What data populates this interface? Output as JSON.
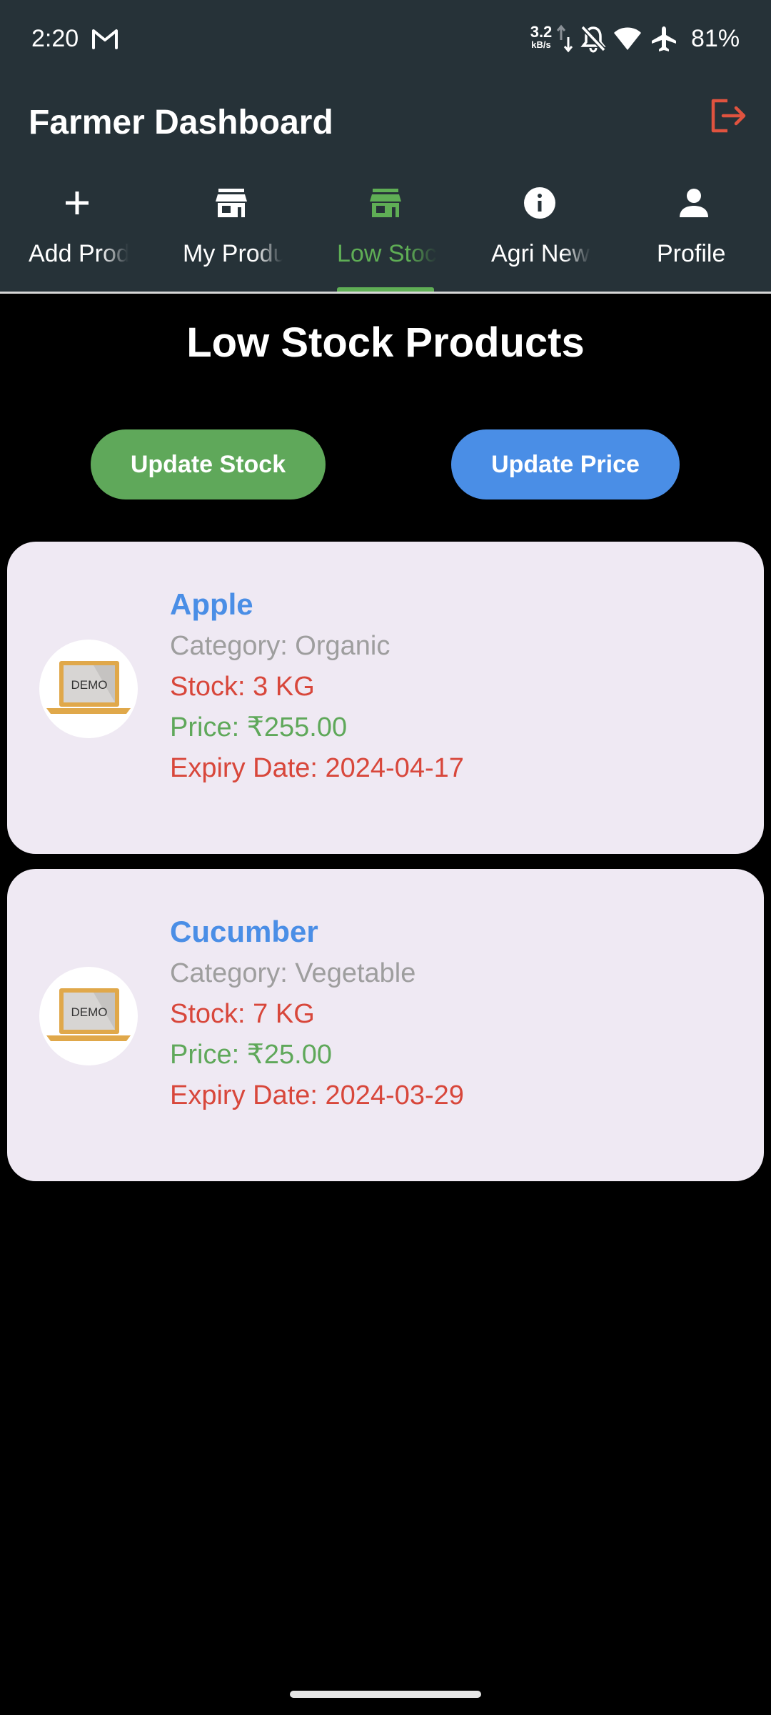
{
  "status_bar": {
    "time": "2:20",
    "net_speed_value": "3.2",
    "net_speed_unit": "kB/s",
    "battery": "81%",
    "icons": [
      "gmail-icon",
      "data-arrows-icon",
      "bell-off-icon",
      "wifi-icon",
      "airplane-icon"
    ]
  },
  "app_bar": {
    "title": "Farmer Dashboard",
    "logout_icon": "logout-icon"
  },
  "tabs": [
    {
      "label": "Add Product",
      "icon": "plus-icon",
      "active": false
    },
    {
      "label": "My Products",
      "icon": "store-icon",
      "active": false
    },
    {
      "label": "Low Stock",
      "icon": "store-icon",
      "active": true
    },
    {
      "label": "Agri News",
      "icon": "info-icon",
      "active": false
    },
    {
      "label": "Profile",
      "icon": "person-icon",
      "active": false
    }
  ],
  "page": {
    "heading": "Low Stock Products",
    "update_stock_label": "Update Stock",
    "update_price_label": "Update Price"
  },
  "products": [
    {
      "name": "Apple",
      "category": "Category: Organic",
      "stock": "Stock: 3 KG",
      "price": "Price: ₹255.00",
      "expiry": "Expiry Date: 2024-04-17",
      "image_text": "DEMO"
    },
    {
      "name": "Cucumber",
      "category": "Category: Vegetable",
      "stock": "Stock: 7 KG",
      "price": "Price: ₹25.00",
      "expiry": "Expiry Date: 2024-03-29",
      "image_text": "DEMO"
    }
  ],
  "colors": {
    "app_bar": "#263238",
    "accent_green": "#5fa85a",
    "accent_blue": "#4a8ee6",
    "alert_red": "#d8473b",
    "card_bg": "#efe9f3"
  }
}
